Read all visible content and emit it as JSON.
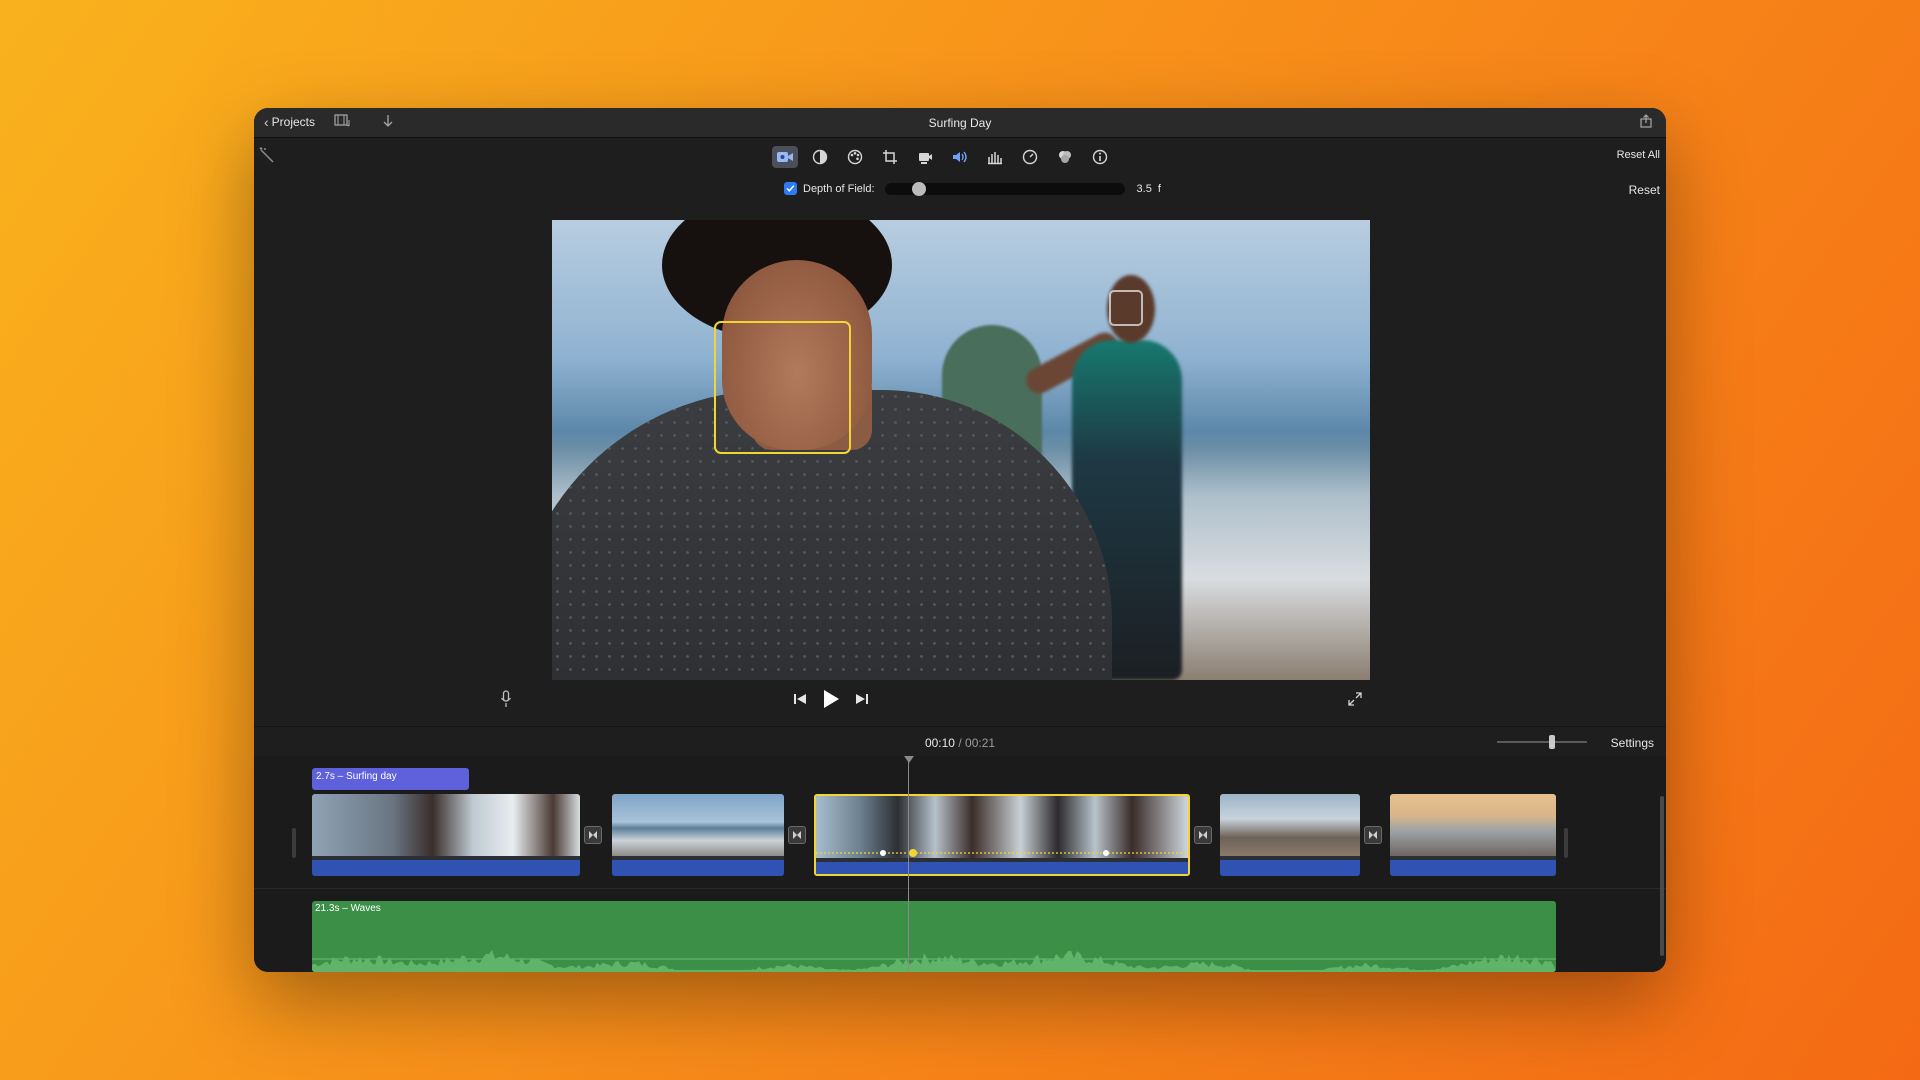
{
  "titlebar": {
    "back_label": "Projects",
    "title": "Surfing Day"
  },
  "toolbar": {
    "tools": [
      "video-overlay",
      "color-balance",
      "color-correction",
      "crop",
      "stabilization",
      "volume",
      "noise-reduction",
      "speed",
      "clip-filter",
      "clip-info"
    ],
    "active_tool": "video-overlay",
    "reset_all_label": "Reset All",
    "reset_label": "Reset"
  },
  "depth_of_field": {
    "label": "Depth of Field:",
    "checked": true,
    "value_text": "3.5",
    "unit": "f",
    "slider_fraction": 0.12
  },
  "timebar": {
    "current": "00:10",
    "separator": "/",
    "total": "00:21",
    "settings_label": "Settings",
    "zoom_fraction": 0.62
  },
  "timeline": {
    "title_clip": "2.7s – Surfing day",
    "music_clip": "21.3s – Waves"
  },
  "colors": {
    "accent_selection": "#f1d633",
    "title_clip": "#5f61dc",
    "audio_track": "#2f52b3",
    "music_track": "#3b8f47"
  }
}
